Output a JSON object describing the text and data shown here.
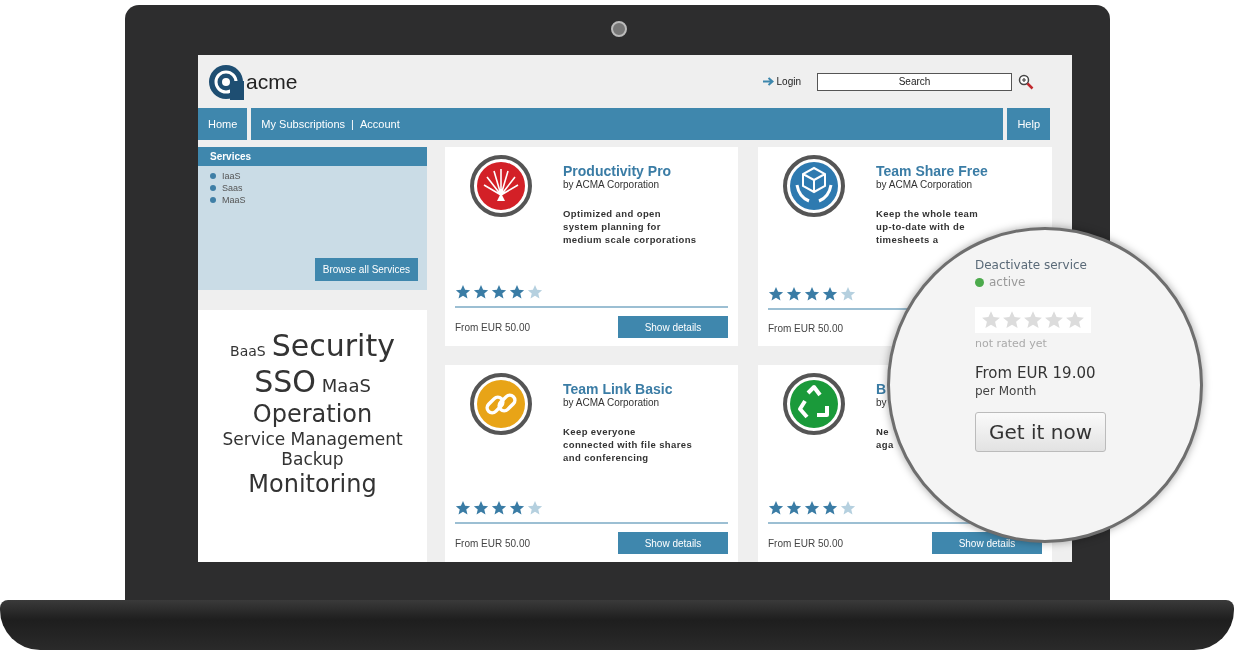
{
  "header": {
    "logo": "acme",
    "login": "Login",
    "search": {
      "placeholder": "Search"
    }
  },
  "nav": {
    "home": "Home",
    "links": [
      "My Subscriptions",
      "Account"
    ],
    "separator": "|",
    "help": "Help"
  },
  "services": {
    "title": "Services",
    "items": [
      "IaaS",
      "Saas",
      "MaaS"
    ],
    "button": "Browse all Services"
  },
  "tag_cloud": {
    "rows": [
      [
        {
          "text": "BaaS",
          "kind": "tiny"
        },
        {
          "text": "Security",
          "kind": "huge"
        }
      ],
      [
        {
          "text": "SSO",
          "kind": "huge"
        },
        {
          "text": "MaaS",
          "kind": "small"
        }
      ],
      [
        {
          "text": "Operation",
          "kind": "large"
        }
      ],
      [
        {
          "text": "Service Management",
          "kind": "medium"
        }
      ],
      [
        {
          "text": "Backup",
          "kind": "medium"
        }
      ],
      [
        {
          "text": "Monitoring",
          "kind": "large"
        }
      ]
    ]
  },
  "products": [
    {
      "name": "Productivity Pro",
      "vendor": "by ACMA Corporation",
      "description": [
        "Optimized and open",
        "system planning for",
        "medium scale corporations"
      ],
      "stars": 4,
      "price": "From EUR 50.00",
      "button": "Show details"
    },
    {
      "name": "Team Share Free",
      "vendor": "by ACMA Corporation",
      "description": [
        "Keep the whole team",
        "up-to-date with de",
        "timesheets a"
      ],
      "stars": 4,
      "price": "From EUR 50.00"
    },
    {
      "name": "Team Link Basic",
      "vendor": "by ACMA Corporation",
      "description": [
        "Keep everyone",
        "connected with file shares",
        "and conferencing"
      ],
      "stars": 4,
      "price": "From EUR 50.00",
      "button": "Show details"
    },
    {
      "name": "B",
      "vendor": "by",
      "description": [
        "Ne",
        "aga"
      ],
      "stars": 4,
      "price": "From EUR 50.00",
      "button": "Show details"
    }
  ],
  "detail_popup": {
    "link": "Deactivate service",
    "status": {
      "label": "active",
      "on": true
    },
    "stars": 0,
    "rating_note": "not rated yet",
    "price": "From EUR 19.00",
    "period": "per Month",
    "button": "Get it now"
  }
}
